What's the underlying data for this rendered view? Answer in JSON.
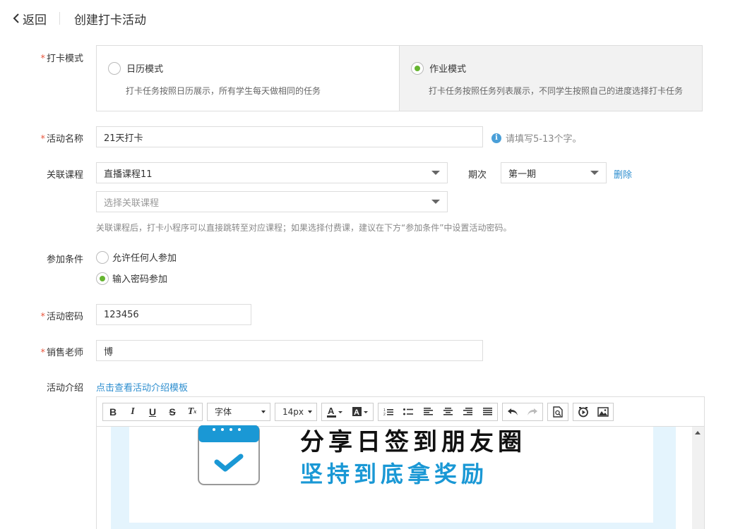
{
  "header": {
    "back_label": "返回",
    "title": "创建打卡活动"
  },
  "form": {
    "mode": {
      "label": "打卡模式",
      "required": true,
      "options": [
        {
          "title": "日历模式",
          "desc": "打卡任务按照日历展示，所有学生每天做相同的任务",
          "selected": false
        },
        {
          "title": "作业模式",
          "desc": "打卡任务按照任务列表展示，不同学生按照自己的进度选择打卡任务",
          "selected": true
        }
      ]
    },
    "name": {
      "label": "活动名称",
      "value": "21天打卡",
      "hint": "请填写5-13个字。"
    },
    "course": {
      "label": "关联课程",
      "selected": "直播课程11",
      "period_label": "期次",
      "period_value": "第一期",
      "delete_label": "删除",
      "add_placeholder": "选择关联课程",
      "help": "关联课程后，打卡小程序可以直接跳转至对应课程；如果选择付费课，建议在下方“参加条件”中设置活动密码。"
    },
    "condition": {
      "label": "参加条件",
      "options": [
        {
          "label": "允许任何人参加",
          "selected": false
        },
        {
          "label": "输入密码参加",
          "selected": true
        }
      ]
    },
    "password": {
      "label": "活动密码",
      "value": "123456"
    },
    "sales": {
      "label": "销售老师",
      "value": "博"
    },
    "intro": {
      "label": "活动介绍",
      "template_link": "点击查看活动介绍模板"
    }
  },
  "editor": {
    "font_select": "字体",
    "size_select": "14px",
    "content_line1": "分享日签到朋友圈",
    "content_line2": "坚持到底拿奖励"
  },
  "colors": {
    "accent_green": "#66b531",
    "link_blue": "#2d8ecf",
    "required_red": "#e9573f",
    "image_blue": "#1a98d5"
  }
}
